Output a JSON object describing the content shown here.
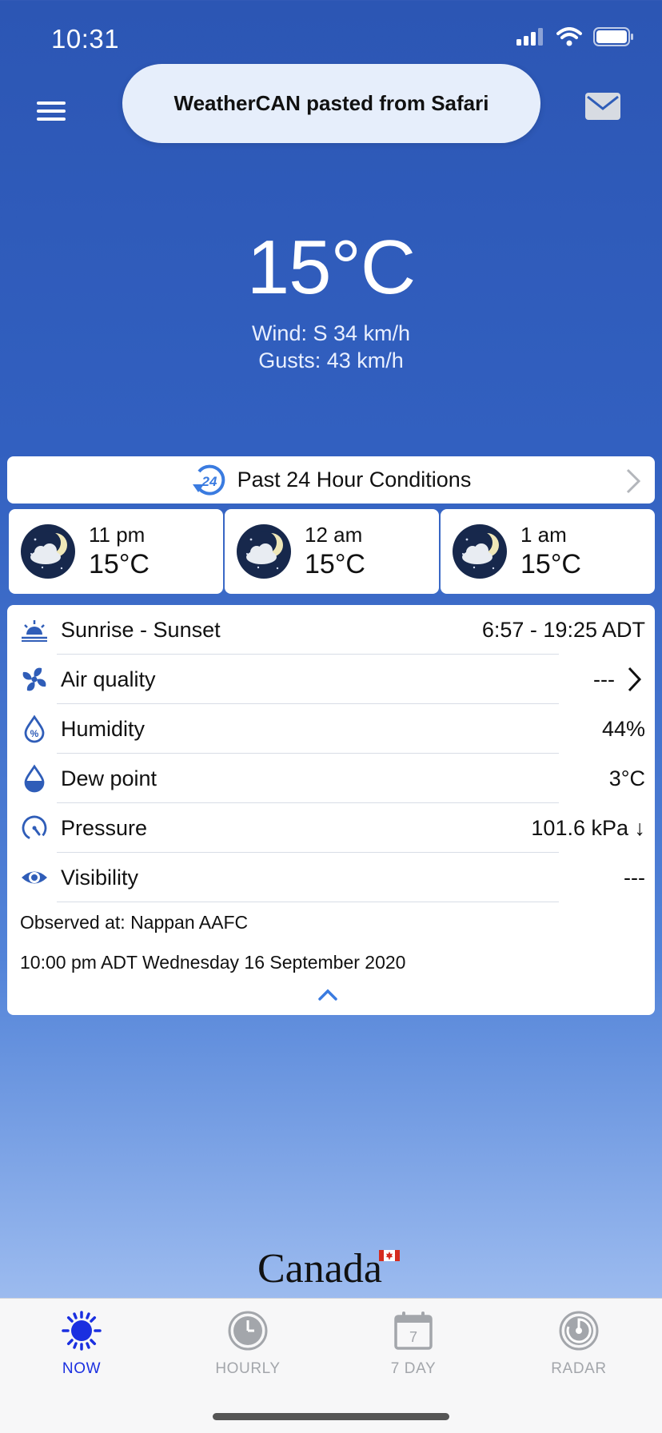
{
  "status_bar": {
    "time": "10:31"
  },
  "toast": {
    "text": "WeatherCAN pasted from Safari"
  },
  "current": {
    "temperature": "15°C",
    "wind": "Wind: S 34 km/h",
    "gusts": "Gusts: 43 km/h"
  },
  "past24": {
    "label": "Past 24 Hour Conditions",
    "icon_text": "24"
  },
  "hourly": [
    {
      "time": "11 pm",
      "temp": "15°C",
      "icon": "cloudy-night-icon"
    },
    {
      "time": "12 am",
      "temp": "15°C",
      "icon": "cloudy-night-icon"
    },
    {
      "time": "1 am",
      "temp": "15°C",
      "icon": "cloudy-night-icon"
    }
  ],
  "details": {
    "rows": [
      {
        "label": "Sunrise - Sunset",
        "value": "6:57 - 19:25 ADT",
        "icon": "sunrise-icon"
      },
      {
        "label": "Air quality",
        "value": "---",
        "icon": "fan-icon"
      },
      {
        "label": "Humidity",
        "value": "44%",
        "icon": "humidity-icon"
      },
      {
        "label": "Dew point",
        "value": "3°C",
        "icon": "dew-drop-icon"
      },
      {
        "label": "Pressure",
        "value": "101.6 kPa ↓",
        "icon": "gauge-icon"
      },
      {
        "label": "Visibility",
        "value": "---",
        "icon": "eye-icon"
      }
    ],
    "observed_at": "Observed at: Nappan AAFC",
    "observed_time": "10:00 pm ADT Wednesday 16 September 2020"
  },
  "footer": {
    "wordmark": "Canada"
  },
  "colors": {
    "accent": "#2f5db8",
    "tab_active": "#1a2fe0",
    "tab_inactive": "#a3a6ab"
  },
  "tabs": [
    {
      "label": "NOW",
      "active": true,
      "icon": "sun-icon"
    },
    {
      "label": "HOURLY",
      "active": false,
      "icon": "clock-icon"
    },
    {
      "label": "7 DAY",
      "active": false,
      "icon": "calendar-icon",
      "icon_text": "7"
    },
    {
      "label": "RADAR",
      "active": false,
      "icon": "radar-icon"
    }
  ]
}
